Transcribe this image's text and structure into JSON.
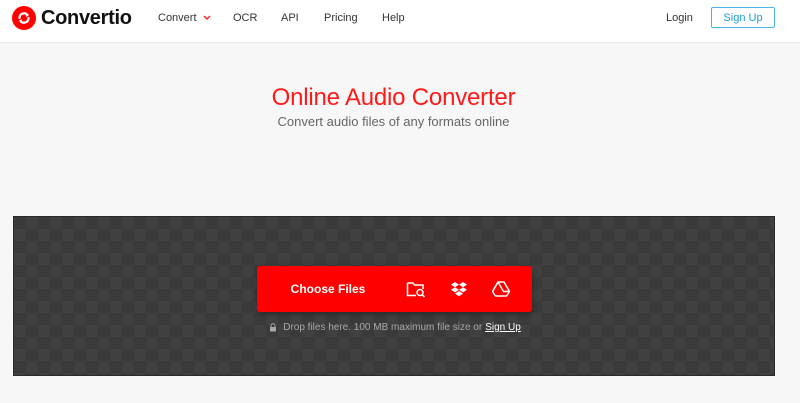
{
  "header": {
    "brand": "Convertio",
    "nav": {
      "convert": "Convert",
      "ocr": "OCR",
      "api": "API",
      "pricing": "Pricing",
      "help": "Help"
    },
    "login": "Login",
    "signup": "Sign Up"
  },
  "hero": {
    "title": "Online Audio Converter",
    "subtitle": "Convert audio files of any formats online"
  },
  "upload": {
    "choose_label": "Choose Files",
    "hint": "Drop files here. 100 MB maximum file size or",
    "hint_link": "Sign Up",
    "icons": [
      "folder-search-icon",
      "dropbox-icon",
      "google-drive-icon",
      "lock-icon"
    ]
  },
  "colors": {
    "brand_red": "#ff0000",
    "signup_blue": "#49b6e4",
    "dropzone_bg": "#3a3a3a"
  }
}
